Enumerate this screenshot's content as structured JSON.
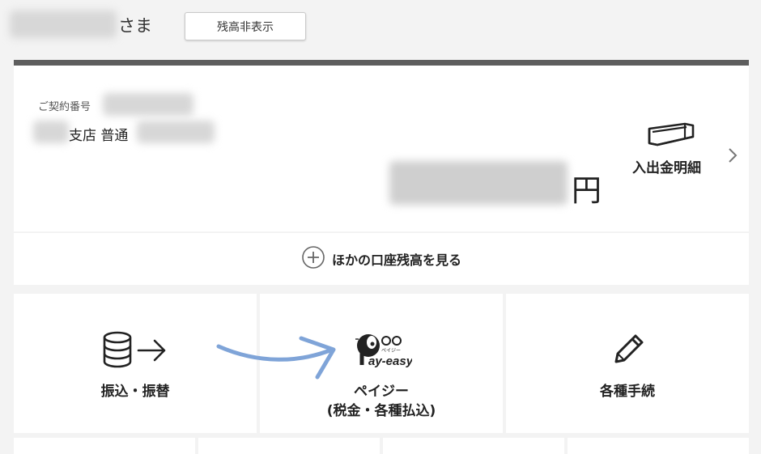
{
  "header": {
    "name_suffix": "さま",
    "hide_balance_button": "残高非表示"
  },
  "account": {
    "contract_label": "ご契約番号",
    "branch_text": "支店 普通",
    "currency": "円",
    "statement_label": "入出金明細"
  },
  "other_accounts": {
    "label": "ほかの口座残高を見る"
  },
  "tiles": [
    {
      "label": "振込・振替",
      "icon": "database-arrow-icon"
    },
    {
      "label_line1": "ペイジー",
      "label_line2": "(税金・各種払込)",
      "icon": "pay-easy-logo",
      "logo_small": "ペイジー",
      "logo_text": "ay-easy"
    },
    {
      "label": "各種手続",
      "icon": "pencil-icon"
    }
  ],
  "colors": {
    "header_strip": "#5e5e5e",
    "annotation_arrow": "#7fa4d8",
    "background": "#f3f3f3"
  }
}
